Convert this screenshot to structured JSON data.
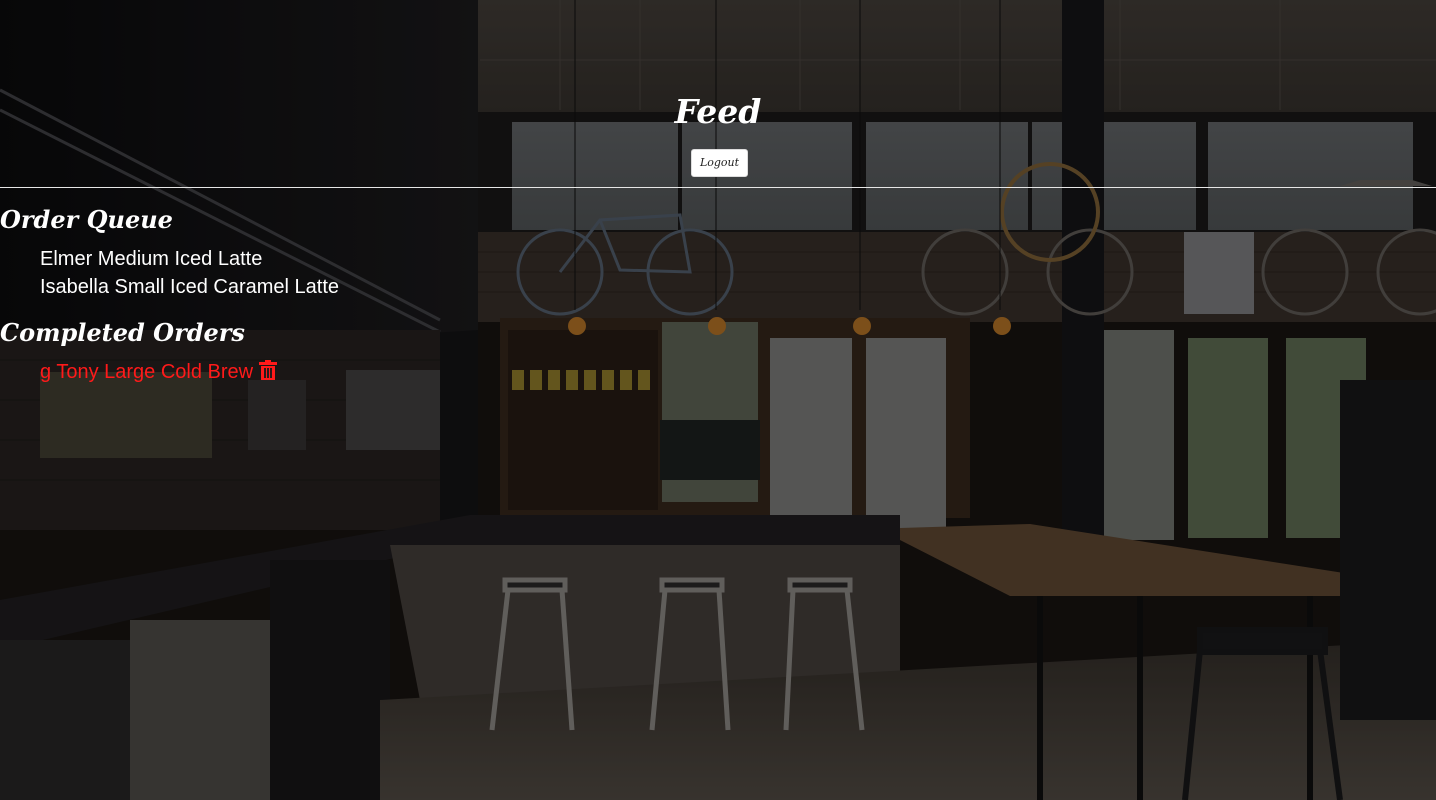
{
  "header": {
    "title": "Feed",
    "logout_label": "Logout"
  },
  "order_queue": {
    "heading": "Order Queue",
    "items": [
      "Elmer Medium Iced Latte",
      "Isabella Small Iced Caramel Latte"
    ]
  },
  "completed_orders": {
    "heading": "Completed Orders",
    "items": [
      {
        "text": "g Tony Large Cold Brew",
        "icon": "trash-icon"
      }
    ]
  },
  "colors": {
    "completed_text": "#ff1a1a",
    "divider": "#e6e6e6"
  }
}
